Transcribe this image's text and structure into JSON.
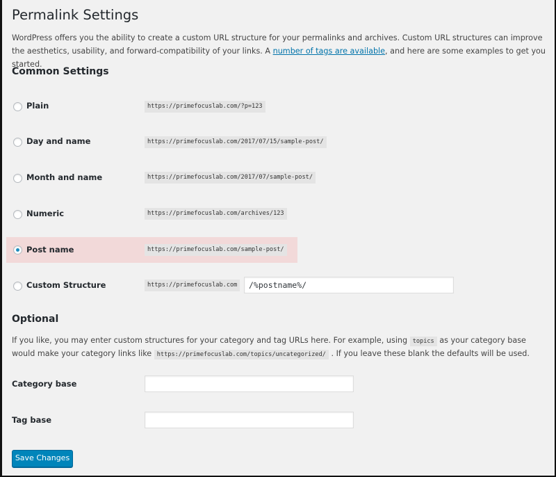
{
  "page": {
    "title": "Permalink Settings",
    "intro_before_link": "WordPress offers you the ability to create a custom URL structure for your permalinks and archives. Custom URL structures can improve the aesthetics, usability, and forward-compatibility of your links. A ",
    "intro_link": "number of tags are available",
    "intro_after_link": ", and here are some examples to get you started."
  },
  "common_settings": {
    "heading": "Common Settings",
    "options": [
      {
        "label": "Plain",
        "example": "https://primefocuslab.com/?p=123",
        "checked": false
      },
      {
        "label": "Day and name",
        "example": "https://primefocuslab.com/2017/07/15/sample-post/",
        "checked": false
      },
      {
        "label": "Month and name",
        "example": "https://primefocuslab.com/2017/07/sample-post/",
        "checked": false
      },
      {
        "label": "Numeric",
        "example": "https://primefocuslab.com/archives/123",
        "checked": false
      },
      {
        "label": "Post name",
        "example": "https://primefocuslab.com/sample-post/",
        "checked": true
      },
      {
        "label": "Custom Structure",
        "example": "https://primefocuslab.com",
        "checked": false,
        "value": "/%postname%/"
      }
    ],
    "highlight_color": "#f2d9d9"
  },
  "optional": {
    "heading": "Optional",
    "text_1": "If you like, you may enter custom structures for your category and tag URLs here. For example, using ",
    "code_1": "topics",
    "text_2": " as your category base would make your category links like ",
    "code_2": "https://primefocuslab.com/topics/uncategorized/",
    "text_3": " . If you leave these blank the defaults will be used.",
    "category_base_label": "Category base",
    "category_base_value": "",
    "tag_base_label": "Tag base",
    "tag_base_value": ""
  },
  "actions": {
    "save_label": "Save Changes",
    "primary_color": "#0085ba"
  }
}
